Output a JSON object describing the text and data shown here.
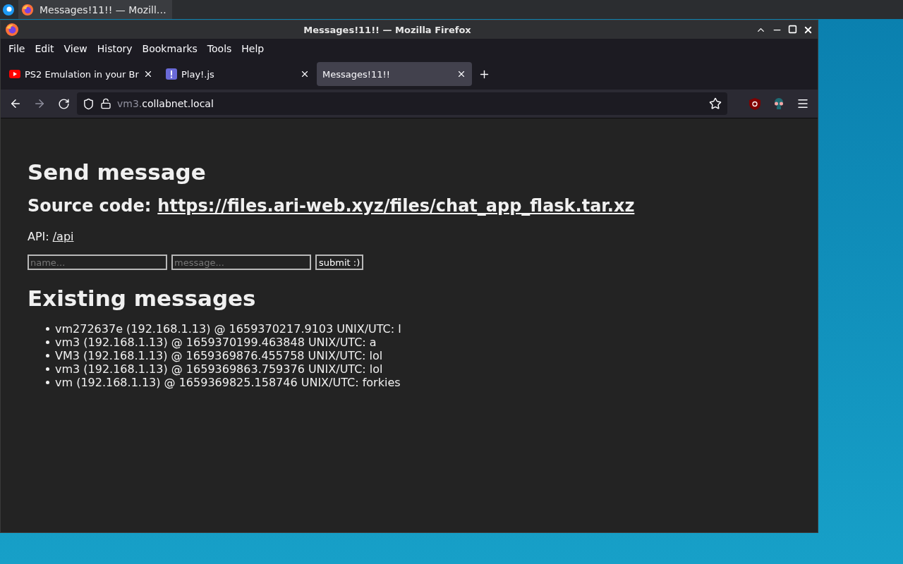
{
  "taskbar": {
    "items": [
      {
        "label": "Messages!11!! — Mozill…",
        "selected": true
      }
    ]
  },
  "window": {
    "title": "Messages!11!! — Mozilla Firefox"
  },
  "menu": [
    "File",
    "Edit",
    "View",
    "History",
    "Bookmarks",
    "Tools",
    "Help"
  ],
  "tabs": [
    {
      "label": "PS2 Emulation in your Br",
      "kind": "video",
      "selected": false
    },
    {
      "label": "Play!.js",
      "kind": "alert",
      "selected": false
    },
    {
      "label": "Messages!11!!",
      "kind": "plain",
      "selected": true
    }
  ],
  "address": {
    "subdomain": "vm3.",
    "domain": "collabnet.local"
  },
  "page": {
    "heading": "Send message",
    "source_label": "Source code:",
    "source_link": "https://files.ari-web.xyz/files/chat_app_flask.tar.xz",
    "api_label": "API:",
    "api_link": "/api",
    "form": {
      "name_placeholder": "name...",
      "message_placeholder": "message...",
      "submit": "submit :)"
    },
    "messages_heading": "Existing messages",
    "messages": [
      "vm272637e (192.168.1.13) @ 1659370217.9103 UNIX/UTC: l",
      "vm3 (192.168.1.13) @ 1659370199.463848 UNIX/UTC: a",
      "VM3 (192.168.1.13) @ 1659369876.455758 UNIX/UTC: lol",
      "vm3 (192.168.1.13) @ 1659369863.759376 UNIX/UTC: lol",
      "vm (192.168.1.13) @ 1659369825.158746 UNIX/UTC: forkies"
    ]
  }
}
